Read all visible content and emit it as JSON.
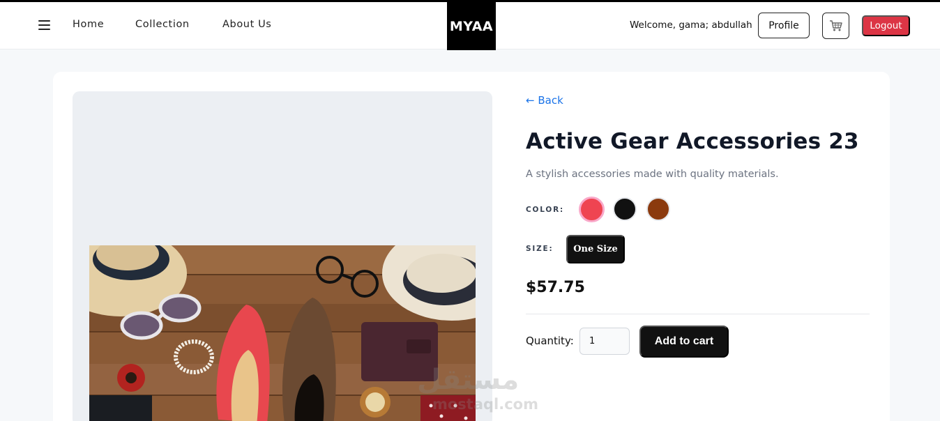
{
  "nav": {
    "links": [
      "Home",
      "Collection",
      "About Us"
    ],
    "logo": "MYAA",
    "welcome": "Welcome, gama; abdullah",
    "profile_label": "Profile",
    "logout_label": "Logout"
  },
  "product": {
    "back_label": "← Back",
    "title": "Active Gear Accessories 23",
    "description": "A stylish accessories made with quality materials.",
    "color_label": "COLOR:",
    "colors": [
      {
        "name": "red",
        "hex": "#ef4451",
        "selected": true
      },
      {
        "name": "black",
        "hex": "#111111",
        "selected": false
      },
      {
        "name": "brown",
        "hex": "#8b3a0e",
        "selected": false
      }
    ],
    "size_label": "SIZE:",
    "size_option": "One Size",
    "price": "$57.75",
    "quantity_label": "Quantity:",
    "quantity_value": "1",
    "add_to_cart_label": "Add to cart"
  },
  "watermark": {
    "arabic": "مستقل",
    "latin": "mostaql.com"
  },
  "colors": {
    "logout": "#dc3545",
    "link": "#1a73e8",
    "dark": "#111111"
  }
}
